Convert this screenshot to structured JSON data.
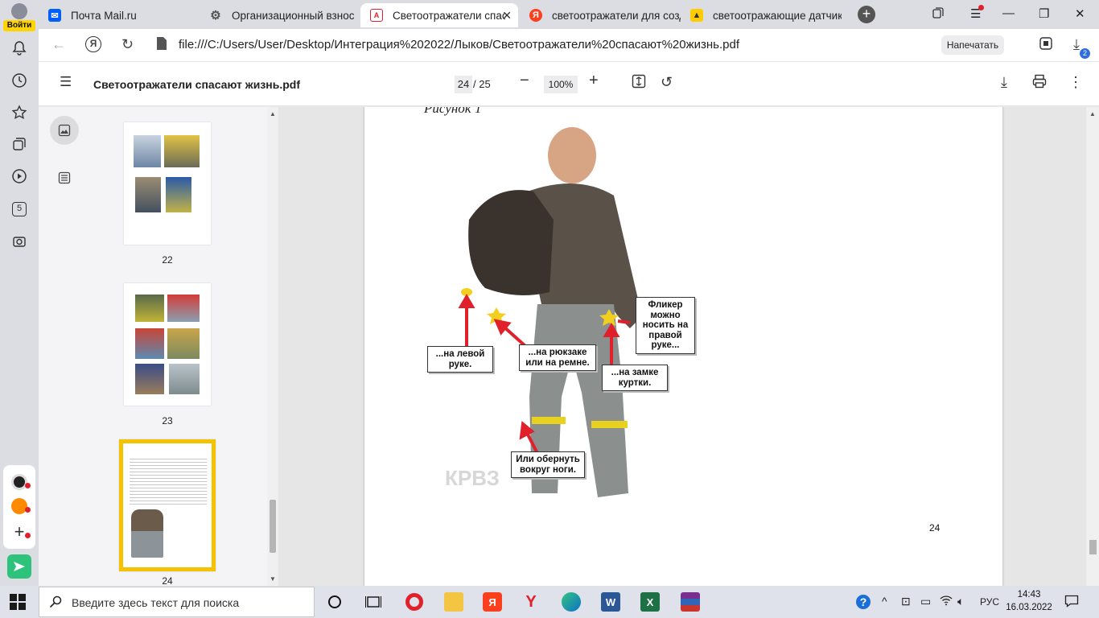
{
  "sidebar_rail": {
    "login_label": "Войти",
    "apps_badge": "5"
  },
  "tabs": [
    {
      "label": "Почта Mail.ru",
      "icon": "mail-icon",
      "icon_color": "#005ff9"
    },
    {
      "label": "Организационный взнос",
      "icon": "gear-icon",
      "icon_color": "#555555"
    },
    {
      "label": "Светоотражатели спасают",
      "icon": "pdf-icon",
      "icon_color": "#e0202a",
      "active": true
    },
    {
      "label": "светоотражатели для созд",
      "icon": "yandex-icon",
      "icon_color": "#fc3f1d"
    },
    {
      "label": "светоотражающие датчик",
      "icon": "image-icon",
      "icon_color": "#ffcc00"
    }
  ],
  "address": {
    "url": "file:///C:/Users/User/Desktop/Интеграция%202022/Лыков/Светоотражатели%20спасают%20жизнь.pdf",
    "print_label": "Напечатать",
    "downloads_count": "2"
  },
  "pdf_toolbar": {
    "title": "Светоотражатели спасают жизнь.pdf",
    "current_page": "24",
    "page_total": "/ 25",
    "zoom": "100%"
  },
  "thumbnails": [
    {
      "page": "22"
    },
    {
      "page": "23"
    },
    {
      "page": "24",
      "selected": true
    }
  ],
  "document": {
    "figure_caption": "Рисунок 1",
    "page_number": "24",
    "watermark": "КРВЗ",
    "callouts": {
      "left_hand": "...на левой руке.",
      "backpack": "...на рюкзаке или на ремне.",
      "jacket": "...на замке куртки.",
      "right_hand": "Фликер можно носить на правой руке...",
      "leg": "Или обернуть вокруг ноги."
    }
  },
  "taskbar": {
    "search_placeholder": "Введите здесь текст для поиска",
    "language": "РУС",
    "time": "14:43",
    "date": "16.03.2022"
  },
  "colors": {
    "accent_yellow": "#ffd400",
    "selection_border": "#f5c200",
    "arrow_red": "#e0202a"
  }
}
